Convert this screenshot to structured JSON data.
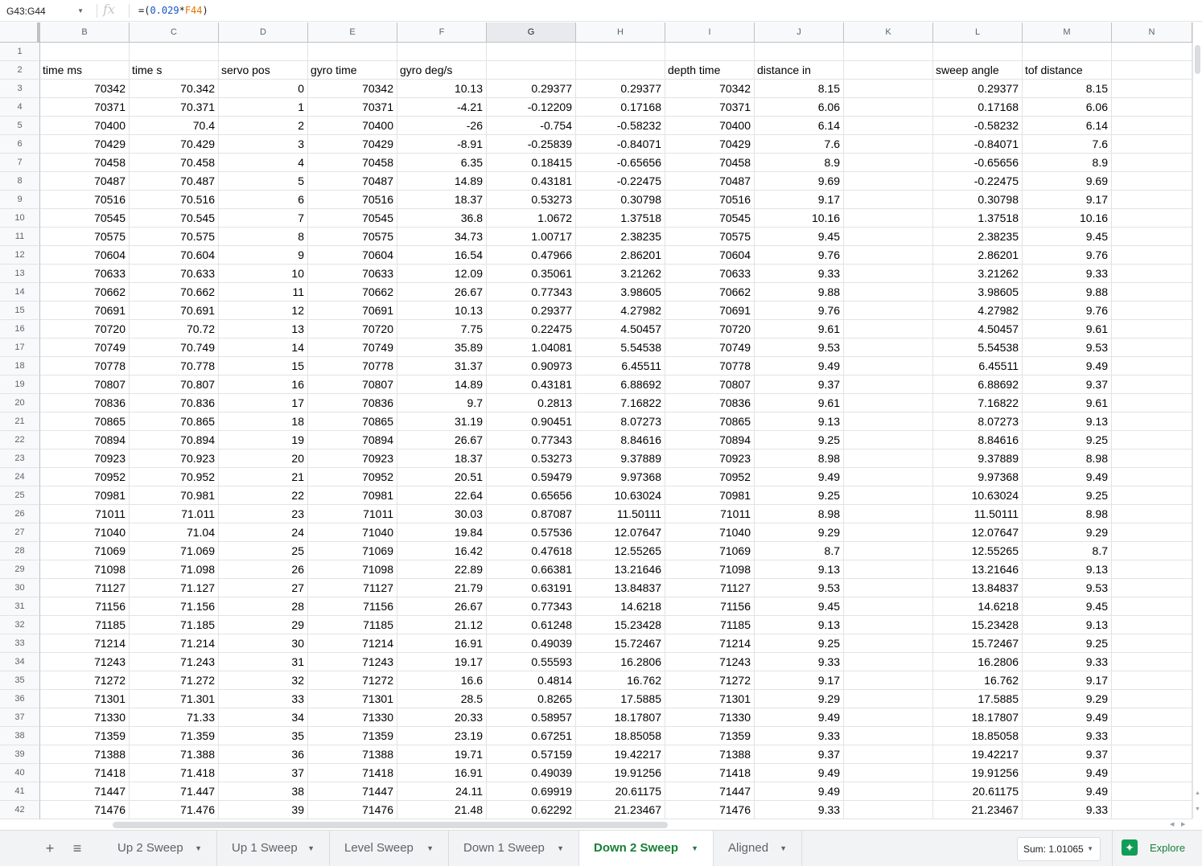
{
  "formula_bar": {
    "name_box": "G43:G44",
    "fx": "fx",
    "formula_prefix": "=(",
    "formula_num": "0.029",
    "formula_op": "*",
    "formula_ref": "F44",
    "formula_suffix": ")"
  },
  "columns": [
    "B",
    "C",
    "D",
    "E",
    "F",
    "G",
    "H",
    "I",
    "J",
    "K",
    "L",
    "M",
    "N"
  ],
  "row_numbers": [
    1,
    2,
    3,
    4,
    5,
    6,
    7,
    8,
    9,
    10,
    11,
    12,
    13,
    14,
    15,
    16,
    17,
    18,
    19,
    20,
    21,
    22,
    23,
    24,
    25,
    26,
    27,
    28,
    29,
    30,
    31,
    32,
    33,
    34,
    35,
    36,
    37,
    38,
    39,
    40,
    41,
    42
  ],
  "headers": {
    "B": "time ms",
    "C": "time s",
    "D": "servo pos",
    "E": "gyro time",
    "F": "gyro deg/s",
    "G": "",
    "H": "",
    "I": "depth time",
    "J": "distance in",
    "K": "",
    "L": "sweep angle",
    "M": "tof distance",
    "N": ""
  },
  "rows": [
    [
      "70342",
      "70.342",
      "0",
      "70342",
      "10.13",
      "0.29377",
      "0.29377",
      "70342",
      "8.15",
      "",
      "0.29377",
      "8.15"
    ],
    [
      "70371",
      "70.371",
      "1",
      "70371",
      "-4.21",
      "-0.12209",
      "0.17168",
      "70371",
      "6.06",
      "",
      "0.17168",
      "6.06"
    ],
    [
      "70400",
      "70.4",
      "2",
      "70400",
      "-26",
      "-0.754",
      "-0.58232",
      "70400",
      "6.14",
      "",
      "-0.58232",
      "6.14"
    ],
    [
      "70429",
      "70.429",
      "3",
      "70429",
      "-8.91",
      "-0.25839",
      "-0.84071",
      "70429",
      "7.6",
      "",
      "-0.84071",
      "7.6"
    ],
    [
      "70458",
      "70.458",
      "4",
      "70458",
      "6.35",
      "0.18415",
      "-0.65656",
      "70458",
      "8.9",
      "",
      "-0.65656",
      "8.9"
    ],
    [
      "70487",
      "70.487",
      "5",
      "70487",
      "14.89",
      "0.43181",
      "-0.22475",
      "70487",
      "9.69",
      "",
      "-0.22475",
      "9.69"
    ],
    [
      "70516",
      "70.516",
      "6",
      "70516",
      "18.37",
      "0.53273",
      "0.30798",
      "70516",
      "9.17",
      "",
      "0.30798",
      "9.17"
    ],
    [
      "70545",
      "70.545",
      "7",
      "70545",
      "36.8",
      "1.0672",
      "1.37518",
      "70545",
      "10.16",
      "",
      "1.37518",
      "10.16"
    ],
    [
      "70575",
      "70.575",
      "8",
      "70575",
      "34.73",
      "1.00717",
      "2.38235",
      "70575",
      "9.45",
      "",
      "2.38235",
      "9.45"
    ],
    [
      "70604",
      "70.604",
      "9",
      "70604",
      "16.54",
      "0.47966",
      "2.86201",
      "70604",
      "9.76",
      "",
      "2.86201",
      "9.76"
    ],
    [
      "70633",
      "70.633",
      "10",
      "70633",
      "12.09",
      "0.35061",
      "3.21262",
      "70633",
      "9.33",
      "",
      "3.21262",
      "9.33"
    ],
    [
      "70662",
      "70.662",
      "11",
      "70662",
      "26.67",
      "0.77343",
      "3.98605",
      "70662",
      "9.88",
      "",
      "3.98605",
      "9.88"
    ],
    [
      "70691",
      "70.691",
      "12",
      "70691",
      "10.13",
      "0.29377",
      "4.27982",
      "70691",
      "9.76",
      "",
      "4.27982",
      "9.76"
    ],
    [
      "70720",
      "70.72",
      "13",
      "70720",
      "7.75",
      "0.22475",
      "4.50457",
      "70720",
      "9.61",
      "",
      "4.50457",
      "9.61"
    ],
    [
      "70749",
      "70.749",
      "14",
      "70749",
      "35.89",
      "1.04081",
      "5.54538",
      "70749",
      "9.53",
      "",
      "5.54538",
      "9.53"
    ],
    [
      "70778",
      "70.778",
      "15",
      "70778",
      "31.37",
      "0.90973",
      "6.45511",
      "70778",
      "9.49",
      "",
      "6.45511",
      "9.49"
    ],
    [
      "70807",
      "70.807",
      "16",
      "70807",
      "14.89",
      "0.43181",
      "6.88692",
      "70807",
      "9.37",
      "",
      "6.88692",
      "9.37"
    ],
    [
      "70836",
      "70.836",
      "17",
      "70836",
      "9.7",
      "0.2813",
      "7.16822",
      "70836",
      "9.61",
      "",
      "7.16822",
      "9.61"
    ],
    [
      "70865",
      "70.865",
      "18",
      "70865",
      "31.19",
      "0.90451",
      "8.07273",
      "70865",
      "9.13",
      "",
      "8.07273",
      "9.13"
    ],
    [
      "70894",
      "70.894",
      "19",
      "70894",
      "26.67",
      "0.77343",
      "8.84616",
      "70894",
      "9.25",
      "",
      "8.84616",
      "9.25"
    ],
    [
      "70923",
      "70.923",
      "20",
      "70923",
      "18.37",
      "0.53273",
      "9.37889",
      "70923",
      "8.98",
      "",
      "9.37889",
      "8.98"
    ],
    [
      "70952",
      "70.952",
      "21",
      "70952",
      "20.51",
      "0.59479",
      "9.97368",
      "70952",
      "9.49",
      "",
      "9.97368",
      "9.49"
    ],
    [
      "70981",
      "70.981",
      "22",
      "70981",
      "22.64",
      "0.65656",
      "10.63024",
      "70981",
      "9.25",
      "",
      "10.63024",
      "9.25"
    ],
    [
      "71011",
      "71.011",
      "23",
      "71011",
      "30.03",
      "0.87087",
      "11.50111",
      "71011",
      "8.98",
      "",
      "11.50111",
      "8.98"
    ],
    [
      "71040",
      "71.04",
      "24",
      "71040",
      "19.84",
      "0.57536",
      "12.07647",
      "71040",
      "9.29",
      "",
      "12.07647",
      "9.29"
    ],
    [
      "71069",
      "71.069",
      "25",
      "71069",
      "16.42",
      "0.47618",
      "12.55265",
      "71069",
      "8.7",
      "",
      "12.55265",
      "8.7"
    ],
    [
      "71098",
      "71.098",
      "26",
      "71098",
      "22.89",
      "0.66381",
      "13.21646",
      "71098",
      "9.13",
      "",
      "13.21646",
      "9.13"
    ],
    [
      "71127",
      "71.127",
      "27",
      "71127",
      "21.79",
      "0.63191",
      "13.84837",
      "71127",
      "9.53",
      "",
      "13.84837",
      "9.53"
    ],
    [
      "71156",
      "71.156",
      "28",
      "71156",
      "26.67",
      "0.77343",
      "14.6218",
      "71156",
      "9.45",
      "",
      "14.6218",
      "9.45"
    ],
    [
      "71185",
      "71.185",
      "29",
      "71185",
      "21.12",
      "0.61248",
      "15.23428",
      "71185",
      "9.13",
      "",
      "15.23428",
      "9.13"
    ],
    [
      "71214",
      "71.214",
      "30",
      "71214",
      "16.91",
      "0.49039",
      "15.72467",
      "71214",
      "9.25",
      "",
      "15.72467",
      "9.25"
    ],
    [
      "71243",
      "71.243",
      "31",
      "71243",
      "19.17",
      "0.55593",
      "16.2806",
      "71243",
      "9.33",
      "",
      "16.2806",
      "9.33"
    ],
    [
      "71272",
      "71.272",
      "32",
      "71272",
      "16.6",
      "0.4814",
      "16.762",
      "71272",
      "9.17",
      "",
      "16.762",
      "9.17"
    ],
    [
      "71301",
      "71.301",
      "33",
      "71301",
      "28.5",
      "0.8265",
      "17.5885",
      "71301",
      "9.29",
      "",
      "17.5885",
      "9.29"
    ],
    [
      "71330",
      "71.33",
      "34",
      "71330",
      "20.33",
      "0.58957",
      "18.17807",
      "71330",
      "9.49",
      "",
      "18.17807",
      "9.49"
    ],
    [
      "71359",
      "71.359",
      "35",
      "71359",
      "23.19",
      "0.67251",
      "18.85058",
      "71359",
      "9.33",
      "",
      "18.85058",
      "9.33"
    ],
    [
      "71388",
      "71.388",
      "36",
      "71388",
      "19.71",
      "0.57159",
      "19.42217",
      "71388",
      "9.37",
      "",
      "19.42217",
      "9.37"
    ],
    [
      "71418",
      "71.418",
      "37",
      "71418",
      "16.91",
      "0.49039",
      "19.91256",
      "71418",
      "9.49",
      "",
      "19.91256",
      "9.49"
    ],
    [
      "71447",
      "71.447",
      "38",
      "71447",
      "24.11",
      "0.69919",
      "20.61175",
      "71447",
      "9.49",
      "",
      "20.61175",
      "9.49"
    ],
    [
      "71476",
      "71.476",
      "39",
      "71476",
      "21.48",
      "0.62292",
      "21.23467",
      "71476",
      "9.33",
      "",
      "21.23467",
      "9.33"
    ]
  ],
  "tabs": [
    {
      "label": "Up 2 Sweep",
      "active": false
    },
    {
      "label": "Up 1 Sweep",
      "active": false
    },
    {
      "label": "Level Sweep",
      "active": false
    },
    {
      "label": "Down 1 Sweep",
      "active": false
    },
    {
      "label": "Down 2 Sweep",
      "active": true
    },
    {
      "label": "Aligned",
      "active": false
    }
  ],
  "sum_label": "Sum: 1.01065",
  "explore_label": "Explore",
  "add_sheet": "+",
  "all_sheets": "≡",
  "accent": "#188038"
}
